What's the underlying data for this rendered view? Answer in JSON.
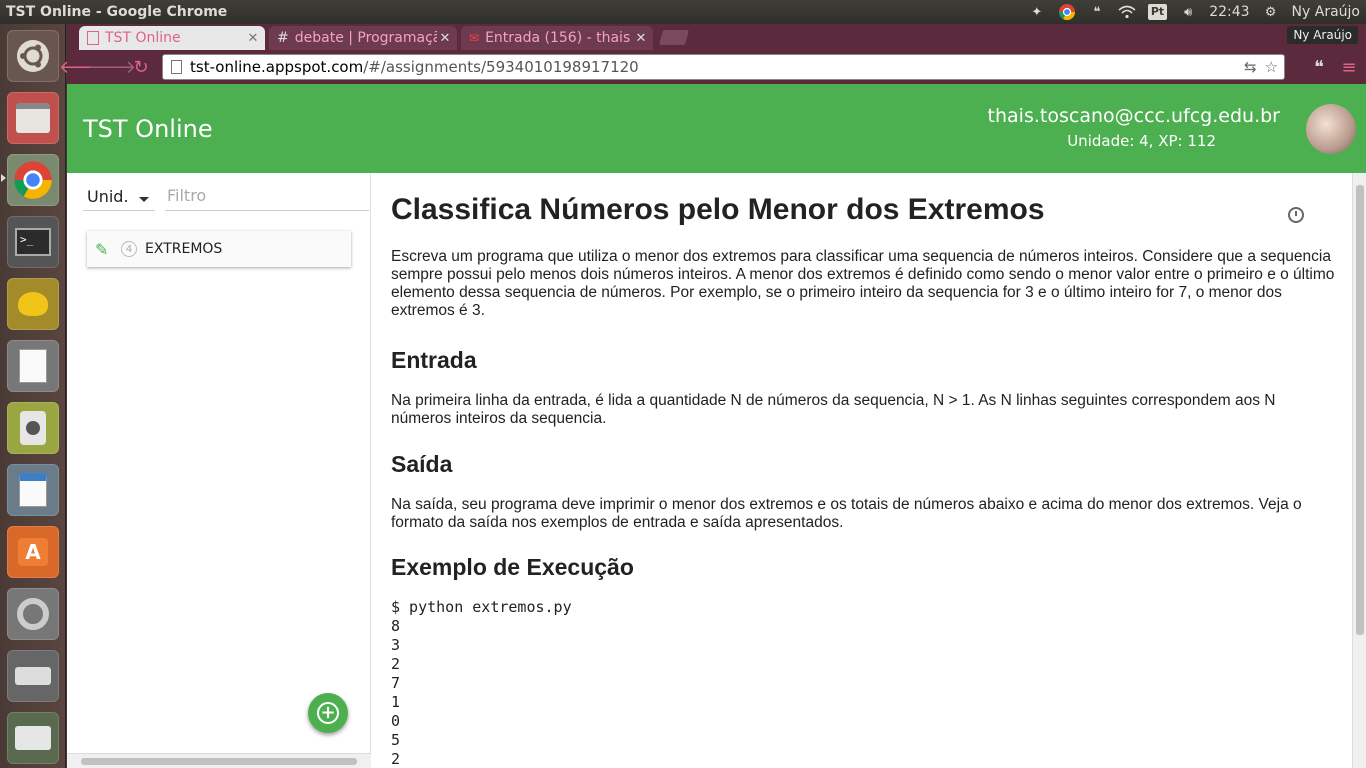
{
  "system": {
    "window_title": "TST Online - Google Chrome",
    "clock": "22:43",
    "user": "Ny Araújo",
    "keyboard_badge": "Pt"
  },
  "tabs": [
    {
      "label": "TST Online",
      "state": "active"
    },
    {
      "label": "debate | Programaçã",
      "state": "inactive"
    },
    {
      "label": "Entrada (156) - thais",
      "state": "inactive"
    }
  ],
  "profile_name": "Ny Araújo",
  "address": {
    "host": "tst-online.appspot.com",
    "path": "/#/assignments/5934010198917120"
  },
  "header": {
    "title": "TST Online",
    "email": "thais.toscano@ccc.ufcg.edu.br",
    "info": "Unidade: 4, XP: 112"
  },
  "sidebar": {
    "unit_select": "Unid.",
    "filter_placeholder": "Filtro",
    "assignments": [
      {
        "number": "4",
        "label": "EXTREMOS"
      }
    ]
  },
  "main": {
    "title": "Classifica Números pelo Menor dos Extremos",
    "intro": "Escreva um programa que utiliza o menor dos extremos para classificar uma sequencia de números inteiros. Considere que a sequencia sempre possui pelo menos dois números inteiros. A menor dos extremos é definido como sendo o menor valor entre o primeiro e o último elemento dessa sequencia de números. Por exemplo, se o primeiro inteiro da sequencia for 3 e o último inteiro for 7, o menor dos extremos é 3.",
    "entrada_heading": "Entrada",
    "entrada_text": "Na primeira linha da entrada, é lida a quantidade N de números da sequencia, N > 1. As N linhas seguintes correspondem aos N números inteiros da sequencia.",
    "saida_heading": "Saída",
    "saida_text": "Na saída, seu programa deve imprimir o menor dos extremos e os totais de números abaixo e acima do menor dos extremos. Veja o formato da saída nos exemplos de entrada e saída apresentados.",
    "exemplo_heading": "Exemplo de Execução",
    "code_lines": [
      "$ python extremos.py",
      "8",
      "3",
      "2",
      "7",
      "1",
      "0",
      "5",
      "2"
    ]
  }
}
